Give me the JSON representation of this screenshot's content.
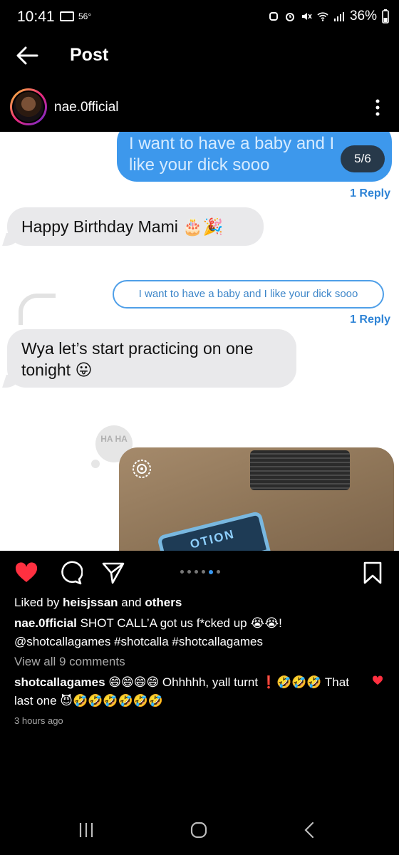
{
  "status_bar": {
    "time": "10:41",
    "temperature": "56°",
    "battery": "36%"
  },
  "header": {
    "title": "Post"
  },
  "author": {
    "username": "nae.0fficial"
  },
  "media": {
    "counter": "5/6",
    "messages": {
      "sent_top": "I want to have a baby and I like your dick sooo",
      "reply_1": "1 Reply",
      "birthday": "Happy Birthday Mami 🎂🎉",
      "quoted": "I want to have a baby and I like your dick sooo",
      "reply_2": "1 Reply",
      "response": "Wya let’s start practicing on one tonight 😛"
    },
    "sticker_text": "HA HA",
    "card_text": "OTION"
  },
  "actions": {
    "carousel_pages": 6,
    "active_page": 5,
    "like_color": "#ff3040"
  },
  "likes": {
    "prefix": "Liked by ",
    "user": "heisjssan",
    "joiner": " and ",
    "others": "others"
  },
  "caption": {
    "user": "nae.0fficial",
    "text": " SHOT CALL’A got us f*cked up 😭😭!",
    "tags": "@shotcallagames #shotcalla #shotcallagames"
  },
  "view_comments": "View all 9 comments",
  "comment": {
    "user": "shotcallagames",
    "text": " 😄😄😄😄 Ohhhhh, yall turnt ❗🤣🤣🤣 That last one 😈🤣🤣🤣🤣🤣🤣"
  },
  "time_ago": "3 hours ago"
}
